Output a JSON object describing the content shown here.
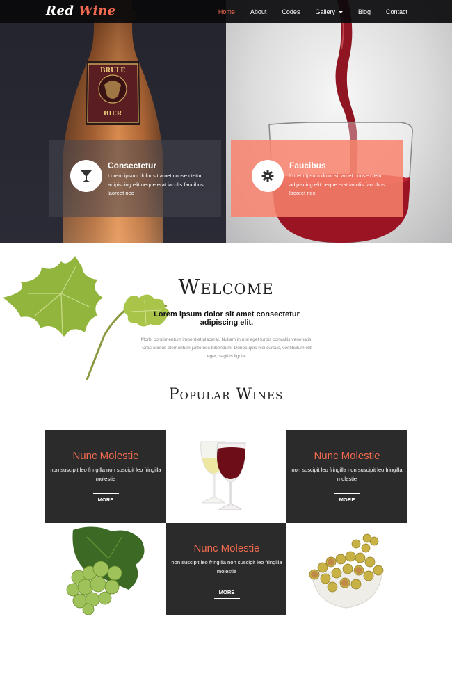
{
  "header": {
    "logo": {
      "part1": "Red",
      "part2": "Wine"
    },
    "nav": [
      "Home",
      "About",
      "Codes",
      "Gallery",
      "Blog",
      "Contact"
    ],
    "active": "Home"
  },
  "hero": {
    "card_left": {
      "title": "Consectetur",
      "text": "Lorem ipsum dolor sit amet conse ctetur adipiscing elit neque erat iaculis faucibus laoreet nec",
      "icon": "cocktail-glass-icon"
    },
    "card_right": {
      "title": "Faucibus",
      "text": "Lorem ipsum dolor sit amet conse ctetur adipiscing elit neque erat iaculis faucibus laoreet nec",
      "icon": "gear-icon"
    }
  },
  "welcome": {
    "title": "Welcome",
    "subtitle": "Lorem ipsum dolor sit amet consectetur adipiscing elit.",
    "text": "Morbi condimentum imperdiet placerat. Nullam in nisl eget turpis convallis venenatis. Cras cursus elementum justo nec bibendum. Donec quis nisi cursus, vestibulum elit eget, sagittis ligula."
  },
  "popular": {
    "title": "Popular Wines",
    "tiles": [
      {
        "title": "Nunc Molestie",
        "text": "non suscipit leo fringilla non suscipit leo fringilla molestie",
        "button": "MORE"
      },
      {
        "title": "Nunc Molestie",
        "text": "non suscipit leo fringilla non suscipit leo fringilla molestie",
        "button": "MORE"
      },
      {
        "title": "Nunc Molestie",
        "text": "non suscipit leo fringilla non suscipit leo fringilla molestie",
        "button": "MORE"
      }
    ]
  },
  "colors": {
    "accent": "#f26a50",
    "dark_tile": "#2b2b2b",
    "nav_bg": "#0a0a0c"
  }
}
